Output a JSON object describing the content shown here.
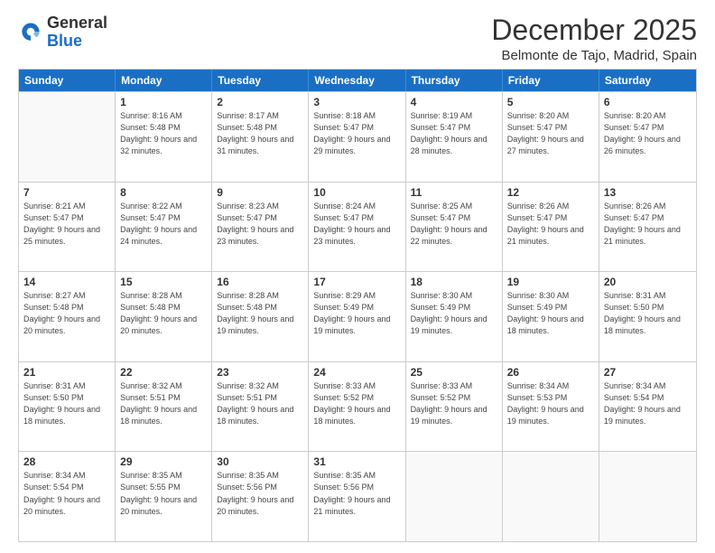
{
  "logo": {
    "general": "General",
    "blue": "Blue"
  },
  "title": "December 2025",
  "subtitle": "Belmonte de Tajo, Madrid, Spain",
  "days": [
    "Sunday",
    "Monday",
    "Tuesday",
    "Wednesday",
    "Thursday",
    "Friday",
    "Saturday"
  ],
  "weeks": [
    [
      {
        "day": "",
        "empty": true
      },
      {
        "day": "1",
        "sunrise": "Sunrise: 8:16 AM",
        "sunset": "Sunset: 5:48 PM",
        "daylight": "Daylight: 9 hours and 32 minutes."
      },
      {
        "day": "2",
        "sunrise": "Sunrise: 8:17 AM",
        "sunset": "Sunset: 5:48 PM",
        "daylight": "Daylight: 9 hours and 31 minutes."
      },
      {
        "day": "3",
        "sunrise": "Sunrise: 8:18 AM",
        "sunset": "Sunset: 5:47 PM",
        "daylight": "Daylight: 9 hours and 29 minutes."
      },
      {
        "day": "4",
        "sunrise": "Sunrise: 8:19 AM",
        "sunset": "Sunset: 5:47 PM",
        "daylight": "Daylight: 9 hours and 28 minutes."
      },
      {
        "day": "5",
        "sunrise": "Sunrise: 8:20 AM",
        "sunset": "Sunset: 5:47 PM",
        "daylight": "Daylight: 9 hours and 27 minutes."
      },
      {
        "day": "6",
        "sunrise": "Sunrise: 8:20 AM",
        "sunset": "Sunset: 5:47 PM",
        "daylight": "Daylight: 9 hours and 26 minutes."
      }
    ],
    [
      {
        "day": "7",
        "sunrise": "Sunrise: 8:21 AM",
        "sunset": "Sunset: 5:47 PM",
        "daylight": "Daylight: 9 hours and 25 minutes."
      },
      {
        "day": "8",
        "sunrise": "Sunrise: 8:22 AM",
        "sunset": "Sunset: 5:47 PM",
        "daylight": "Daylight: 9 hours and 24 minutes."
      },
      {
        "day": "9",
        "sunrise": "Sunrise: 8:23 AM",
        "sunset": "Sunset: 5:47 PM",
        "daylight": "Daylight: 9 hours and 23 minutes."
      },
      {
        "day": "10",
        "sunrise": "Sunrise: 8:24 AM",
        "sunset": "Sunset: 5:47 PM",
        "daylight": "Daylight: 9 hours and 23 minutes."
      },
      {
        "day": "11",
        "sunrise": "Sunrise: 8:25 AM",
        "sunset": "Sunset: 5:47 PM",
        "daylight": "Daylight: 9 hours and 22 minutes."
      },
      {
        "day": "12",
        "sunrise": "Sunrise: 8:26 AM",
        "sunset": "Sunset: 5:47 PM",
        "daylight": "Daylight: 9 hours and 21 minutes."
      },
      {
        "day": "13",
        "sunrise": "Sunrise: 8:26 AM",
        "sunset": "Sunset: 5:47 PM",
        "daylight": "Daylight: 9 hours and 21 minutes."
      }
    ],
    [
      {
        "day": "14",
        "sunrise": "Sunrise: 8:27 AM",
        "sunset": "Sunset: 5:48 PM",
        "daylight": "Daylight: 9 hours and 20 minutes."
      },
      {
        "day": "15",
        "sunrise": "Sunrise: 8:28 AM",
        "sunset": "Sunset: 5:48 PM",
        "daylight": "Daylight: 9 hours and 20 minutes."
      },
      {
        "day": "16",
        "sunrise": "Sunrise: 8:28 AM",
        "sunset": "Sunset: 5:48 PM",
        "daylight": "Daylight: 9 hours and 19 minutes."
      },
      {
        "day": "17",
        "sunrise": "Sunrise: 8:29 AM",
        "sunset": "Sunset: 5:49 PM",
        "daylight": "Daylight: 9 hours and 19 minutes."
      },
      {
        "day": "18",
        "sunrise": "Sunrise: 8:30 AM",
        "sunset": "Sunset: 5:49 PM",
        "daylight": "Daylight: 9 hours and 19 minutes."
      },
      {
        "day": "19",
        "sunrise": "Sunrise: 8:30 AM",
        "sunset": "Sunset: 5:49 PM",
        "daylight": "Daylight: 9 hours and 18 minutes."
      },
      {
        "day": "20",
        "sunrise": "Sunrise: 8:31 AM",
        "sunset": "Sunset: 5:50 PM",
        "daylight": "Daylight: 9 hours and 18 minutes."
      }
    ],
    [
      {
        "day": "21",
        "sunrise": "Sunrise: 8:31 AM",
        "sunset": "Sunset: 5:50 PM",
        "daylight": "Daylight: 9 hours and 18 minutes."
      },
      {
        "day": "22",
        "sunrise": "Sunrise: 8:32 AM",
        "sunset": "Sunset: 5:51 PM",
        "daylight": "Daylight: 9 hours and 18 minutes."
      },
      {
        "day": "23",
        "sunrise": "Sunrise: 8:32 AM",
        "sunset": "Sunset: 5:51 PM",
        "daylight": "Daylight: 9 hours and 18 minutes."
      },
      {
        "day": "24",
        "sunrise": "Sunrise: 8:33 AM",
        "sunset": "Sunset: 5:52 PM",
        "daylight": "Daylight: 9 hours and 18 minutes."
      },
      {
        "day": "25",
        "sunrise": "Sunrise: 8:33 AM",
        "sunset": "Sunset: 5:52 PM",
        "daylight": "Daylight: 9 hours and 19 minutes."
      },
      {
        "day": "26",
        "sunrise": "Sunrise: 8:34 AM",
        "sunset": "Sunset: 5:53 PM",
        "daylight": "Daylight: 9 hours and 19 minutes."
      },
      {
        "day": "27",
        "sunrise": "Sunrise: 8:34 AM",
        "sunset": "Sunset: 5:54 PM",
        "daylight": "Daylight: 9 hours and 19 minutes."
      }
    ],
    [
      {
        "day": "28",
        "sunrise": "Sunrise: 8:34 AM",
        "sunset": "Sunset: 5:54 PM",
        "daylight": "Daylight: 9 hours and 20 minutes."
      },
      {
        "day": "29",
        "sunrise": "Sunrise: 8:35 AM",
        "sunset": "Sunset: 5:55 PM",
        "daylight": "Daylight: 9 hours and 20 minutes."
      },
      {
        "day": "30",
        "sunrise": "Sunrise: 8:35 AM",
        "sunset": "Sunset: 5:56 PM",
        "daylight": "Daylight: 9 hours and 20 minutes."
      },
      {
        "day": "31",
        "sunrise": "Sunrise: 8:35 AM",
        "sunset": "Sunset: 5:56 PM",
        "daylight": "Daylight: 9 hours and 21 minutes."
      },
      {
        "day": "",
        "empty": true
      },
      {
        "day": "",
        "empty": true
      },
      {
        "day": "",
        "empty": true
      }
    ]
  ]
}
